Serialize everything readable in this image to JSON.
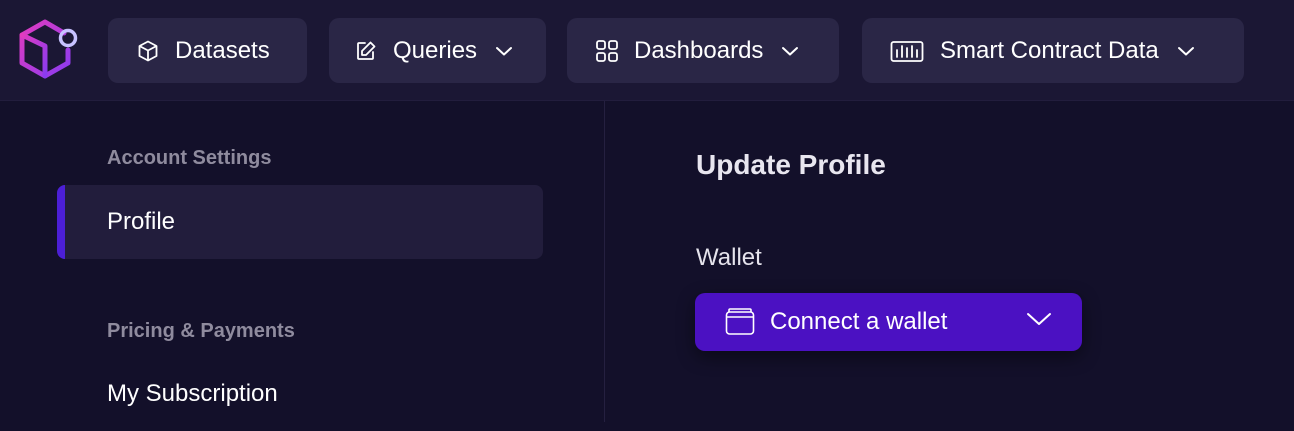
{
  "nav": {
    "logo": "logo-icon",
    "items": [
      {
        "label": "Datasets",
        "icon": "cube-icon",
        "has_dropdown": false
      },
      {
        "label": "Queries",
        "icon": "edit-icon",
        "has_dropdown": true
      },
      {
        "label": "Dashboards",
        "icon": "grid-icon",
        "has_dropdown": true
      },
      {
        "label": "Smart Contract Data",
        "icon": "bar-chart-icon",
        "has_dropdown": true
      }
    ]
  },
  "sidebar": {
    "sections": [
      {
        "heading": "Account Settings",
        "items": [
          {
            "label": "Profile",
            "active": true
          }
        ]
      },
      {
        "heading": "Pricing & Payments",
        "items": [
          {
            "label": "My Subscription",
            "active": false
          }
        ]
      }
    ]
  },
  "main": {
    "title": "Update Profile",
    "wallet_label": "Wallet",
    "wallet_button": {
      "label": "Connect a wallet",
      "icon": "wallet-icon",
      "chevron": "chevron-down-icon"
    }
  },
  "colors": {
    "background": "#13102a",
    "topbar": "#1b1734",
    "nav_button": "#2a2646",
    "active_item": "#221d3c",
    "accent": "#4c1fd6",
    "primary_button": "#4b11c2",
    "muted_text": "#8f8b9e",
    "logo_gradient": [
      "#e13bbf",
      "#8a3bf0"
    ]
  }
}
